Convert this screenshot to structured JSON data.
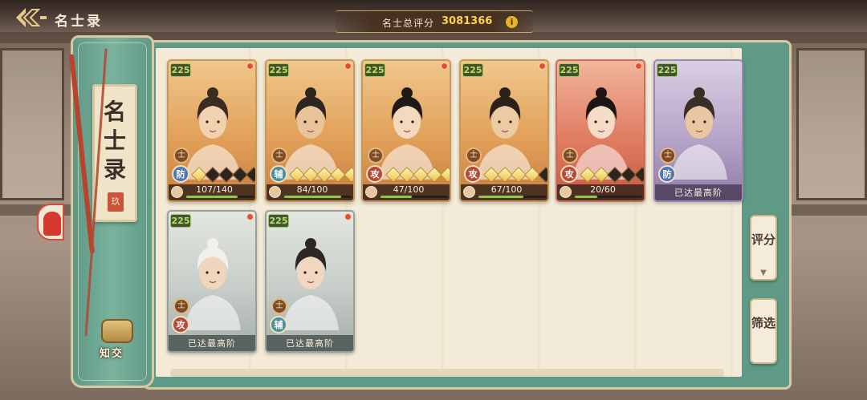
{
  "header": {
    "title": "名士录",
    "score_label": "名士总评分",
    "score_value": "3081366",
    "info_glyph": "i"
  },
  "left_panel": {
    "title_vertical": "名士录",
    "seal": "玖",
    "friend_label": "知交"
  },
  "right_buttons": {
    "rate_label": "评分",
    "filter_label": "筛选"
  },
  "cards": [
    {
      "level": "225",
      "rank": "士",
      "role": "防",
      "stars_on": 1,
      "stars_total": 5,
      "progress_text": "107/140",
      "progress": 0.76,
      "theme": "orange",
      "has_dot": true
    },
    {
      "level": "225",
      "rank": "士",
      "role": "辅",
      "stars_on": 5,
      "stars_total": 5,
      "progress_text": "84/100",
      "progress": 0.84,
      "theme": "orange",
      "has_dot": true
    },
    {
      "level": "225",
      "rank": "士",
      "role": "攻",
      "stars_on": 5,
      "stars_total": 5,
      "progress_text": "47/100",
      "progress": 0.47,
      "theme": "orange",
      "has_dot": true
    },
    {
      "level": "225",
      "rank": "士",
      "role": "攻",
      "stars_on": 4,
      "stars_total": 5,
      "progress_text": "67/100",
      "progress": 0.67,
      "theme": "orange",
      "has_dot": true
    },
    {
      "level": "225",
      "rank": "士",
      "role": "攻",
      "stars_on": 2,
      "stars_total": 5,
      "progress_text": "20/60",
      "progress": 0.33,
      "theme": "red",
      "has_dot": true
    },
    {
      "level": "225",
      "rank": "士",
      "role": "防",
      "maxed_text": "已达最高阶",
      "theme": "purple",
      "has_dot": false
    },
    {
      "level": "225",
      "rank": "士",
      "role": "攻",
      "maxed_text": "已达最高阶",
      "theme": "gray",
      "has_dot": true
    },
    {
      "level": "225",
      "rank": "士",
      "role": "辅",
      "maxed_text": "已达最高阶",
      "theme": "gray",
      "has_dot": true
    }
  ],
  "colors": {
    "accent_gold": "#ffd24a",
    "panel_green": "#5f9a87",
    "paper": "#f3ebd8"
  }
}
